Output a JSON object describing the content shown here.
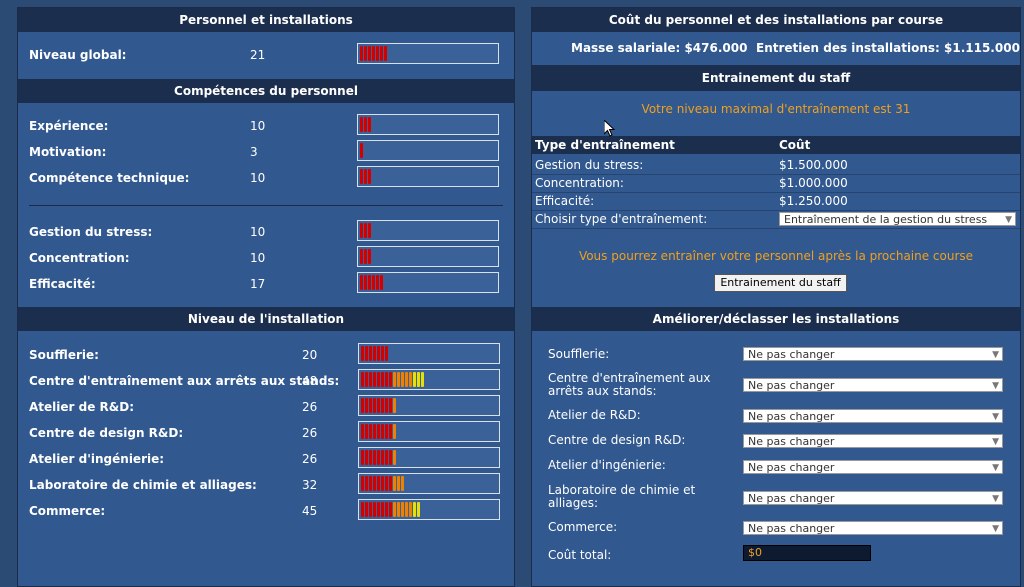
{
  "left": {
    "header1": "Personnel et installations",
    "overall": {
      "label": "Niveau global:",
      "value": "21",
      "level": 21
    },
    "header2": "Compétences du personnel",
    "skills": [
      {
        "label": "Expérience:",
        "value": "10",
        "level": 10
      },
      {
        "label": "Motivation:",
        "value": "3",
        "level": 3
      },
      {
        "label": "Compétence technique:",
        "value": "10",
        "level": 10
      }
    ],
    "skills2": [
      {
        "label": "Gestion du stress:",
        "value": "10",
        "level": 10
      },
      {
        "label": "Concentration:",
        "value": "10",
        "level": 10
      },
      {
        "label": "Efficacité:",
        "value": "17",
        "level": 17
      }
    ],
    "header3": "Niveau de l'installation",
    "facilities": [
      {
        "label": "Soufflerie:",
        "value": "20",
        "level": 20
      },
      {
        "label": "Centre d'entraînement aux arrêts aux stands:",
        "value": "48",
        "level": 48
      },
      {
        "label": "Atelier de R&D:",
        "value": "26",
        "level": 26
      },
      {
        "label": "Centre de design R&D:",
        "value": "26",
        "level": 26
      },
      {
        "label": "Atelier d'ingénierie:",
        "value": "26",
        "level": 26
      },
      {
        "label": "Laboratoire de chimie et alliages:",
        "value": "32",
        "level": 32
      },
      {
        "label": "Commerce:",
        "value": "45",
        "level": 45
      }
    ]
  },
  "right": {
    "header1": "Coût du personnel et des installations par course",
    "salary": "Masse salariale: $476.000",
    "maintenance": "Entretien des installations: $1.115.000",
    "header2": "Entrainement du staff",
    "max_level": "Votre niveau maximal d'entraînement est 31",
    "table_head": {
      "type": "Type d'entraînement",
      "cost": "Coût"
    },
    "table_rows": [
      {
        "type": "Gestion du stress:",
        "cost": "$1.500.000"
      },
      {
        "type": "Concentration:",
        "cost": "$1.000.000"
      },
      {
        "type": "Efficacité:",
        "cost": "$1.250.000"
      }
    ],
    "choose_label": "Choisir type d'entraînement:",
    "choose_value": "Entraînement de la gestion du stress",
    "notice": "Vous pourrez entraîner votre personnel après la prochaine course",
    "train_button": "Entrainement du staff",
    "header3": "Améliorer/déclasser les installations",
    "upgrades": [
      {
        "label": "Soufflerie:",
        "value": "Ne pas changer"
      },
      {
        "label": "Centre d'entraînement aux arrêts aux stands:",
        "value": "Ne pas changer"
      },
      {
        "label": "Atelier de R&D:",
        "value": "Ne pas changer"
      },
      {
        "label": "Centre de design R&D:",
        "value": "Ne pas changer"
      },
      {
        "label": "Atelier d'ingénierie:",
        "value": "Ne pas changer"
      },
      {
        "label": "Laboratoire de chimie et alliages:",
        "value": "Ne pas changer"
      },
      {
        "label": "Commerce:",
        "value": "Ne pas changer"
      }
    ],
    "total_label": "Coût total:",
    "total_value": "$0"
  },
  "colors": {
    "bar_red": "#d40000",
    "bar_orange": "#f08000",
    "bar_yellow": "#e8e000",
    "accent_orange": "#f0a020"
  }
}
